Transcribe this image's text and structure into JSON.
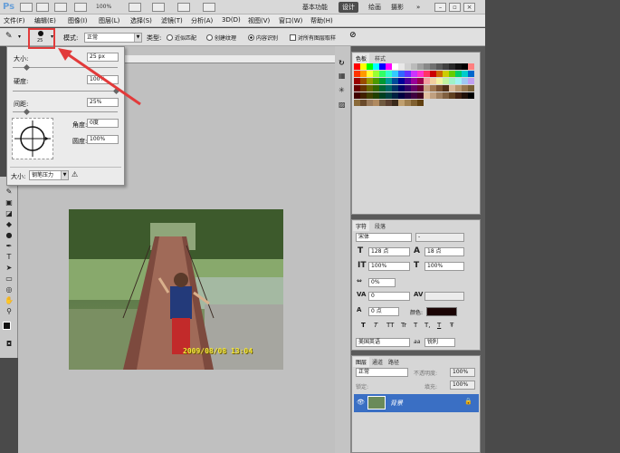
{
  "titlebar": {
    "logo": "Ps",
    "zoom": "100%",
    "workspaces": [
      "基本功能",
      "设计",
      "绘画",
      "摄影"
    ],
    "active_workspace": "设计",
    "more": "»"
  },
  "menu": [
    "文件(F)",
    "编辑(E)",
    "图像(I)",
    "图层(L)",
    "选择(S)",
    "滤镜(T)",
    "分析(A)",
    "3D(D)",
    "视图(V)",
    "窗口(W)",
    "帮助(H)"
  ],
  "options": {
    "brush_size": "25",
    "mode_label": "模式:",
    "mode_value": "正常",
    "type_label": "类型:",
    "type_options": [
      "近似匹配",
      "创建纹理",
      "内容识别"
    ],
    "selected_type": "内容识别",
    "sample_all": "对所有图层取样"
  },
  "brush_popup": {
    "size_label": "大小:",
    "size_value": "25 px",
    "hardness_label": "硬度:",
    "hardness_value": "100%",
    "spacing_label": "间距:",
    "spacing_value": "25%",
    "angle_label": "角度:",
    "angle_value": "0度",
    "roundness_label": "圆度:",
    "roundness_value": "100%",
    "bottom_label": "大小:",
    "bottom_value": "钢笔压力",
    "size_fraction": 0.12,
    "hardness_fraction": 1.0,
    "spacing_fraction": 0.12
  },
  "swatches_panel": {
    "tabs": [
      "色板",
      "样式"
    ]
  },
  "character_panel": {
    "tabs": [
      "字符",
      "段落"
    ],
    "font_family": "宋体",
    "font_style": "-",
    "font_size": "128 点",
    "leading": "18 点",
    "vertical_scale": "100%",
    "horizontal_scale": "100%",
    "tracking_pct": "0%",
    "kerning": "0",
    "baseline": "0 点",
    "color_label": "颜色:",
    "type_buttons": [
      "T",
      "T",
      "TT",
      "Tr",
      "T",
      "T,",
      "T",
      "Ŧ"
    ],
    "language": "美国英语",
    "aa_icon": "aa",
    "antialias": "锐利"
  },
  "layers_panel": {
    "tabs": [
      "图层",
      "通道",
      "路径"
    ],
    "blend_mode": "正常",
    "opacity_label": "不透明度:",
    "opacity": "100%",
    "lock_label": "锁定:",
    "fill_label": "填充:",
    "fill": "100%",
    "layer_name": "背景"
  },
  "photo": {
    "timestamp": "2009/08/08 13:04"
  },
  "colors": {
    "highlight": "#e23a3a",
    "selected_layer": "#3a6fc4"
  }
}
